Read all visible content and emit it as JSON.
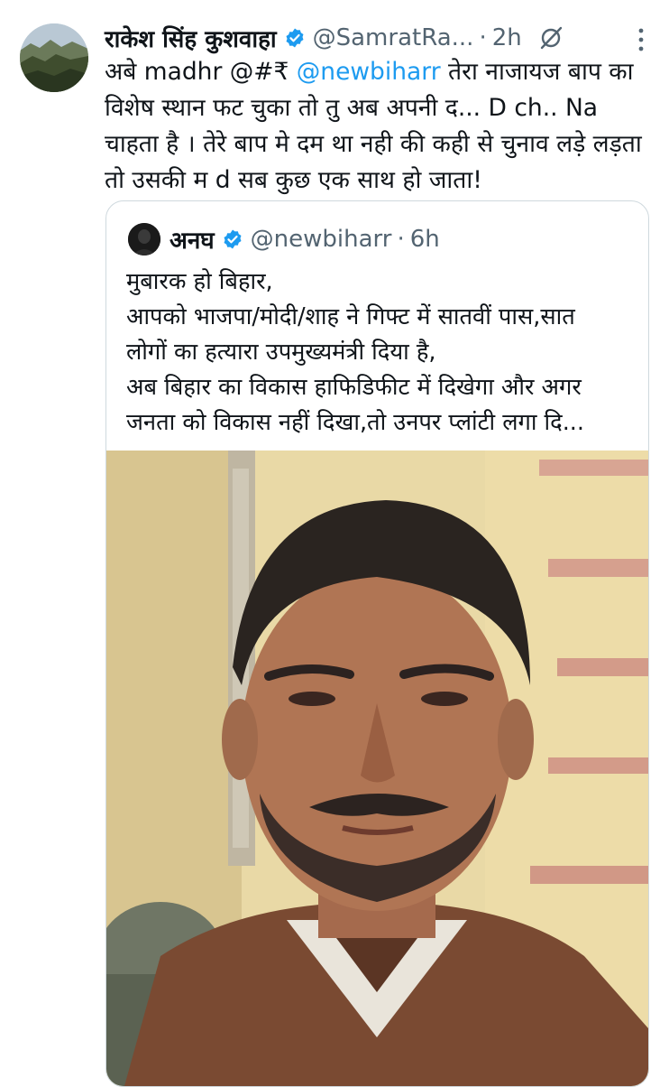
{
  "tweet": {
    "author_name": "राकेश सिंह कुशवाहा",
    "handle": "@SamratRa...",
    "separator": "·",
    "time": "2h",
    "lines": [
      {
        "parts": [
          {
            "text": "अबे madhr @#₹ ",
            "mention": false
          },
          {
            "text": "@newbiharr",
            "mention": true
          },
          {
            "text": " तेरा नाजायज बाप का",
            "mention": false
          }
        ]
      },
      {
        "parts": [
          {
            "text": "विशेष स्थान फट चुका तो तु अब अपनी द... D ch..  Na",
            "mention": false
          }
        ]
      },
      {
        "parts": [
          {
            "text": "चाहता है । तेरे बाप मे दम था नही की कही से चुनाव लड़े लड़ता",
            "mention": false
          }
        ]
      },
      {
        "parts": [
          {
            "text": "तो उसकी म d सब कुछ एक साथ हो जाता!",
            "mention": false
          }
        ]
      }
    ]
  },
  "quote": {
    "author_name": "अनघ",
    "handle": "@newbiharr",
    "separator": "·",
    "time": "6h",
    "lines": [
      "मुबारक हो बिहार,",
      "आपको भाजपा/मोदी/शाह ने गिफ्ट में सातवीं पास,सात",
      "लोगों का हत्यारा उपमुख्यमंत्री दिया है,",
      "अब बिहार का विकास हाफिडिफीट में दिखेगा और अगर",
      "जनता को विकास नहीं दिखा,तो उनपर प्लांटी लगा दि..."
    ]
  },
  "icons": {
    "verified": "verified-badge-icon",
    "grok": "grok-icon",
    "more": "more-options-icon"
  },
  "colors": {
    "link": "#1d9bf0",
    "secondary_text": "#536471",
    "border": "#cfd9de",
    "verified": "#1d9bf0"
  }
}
